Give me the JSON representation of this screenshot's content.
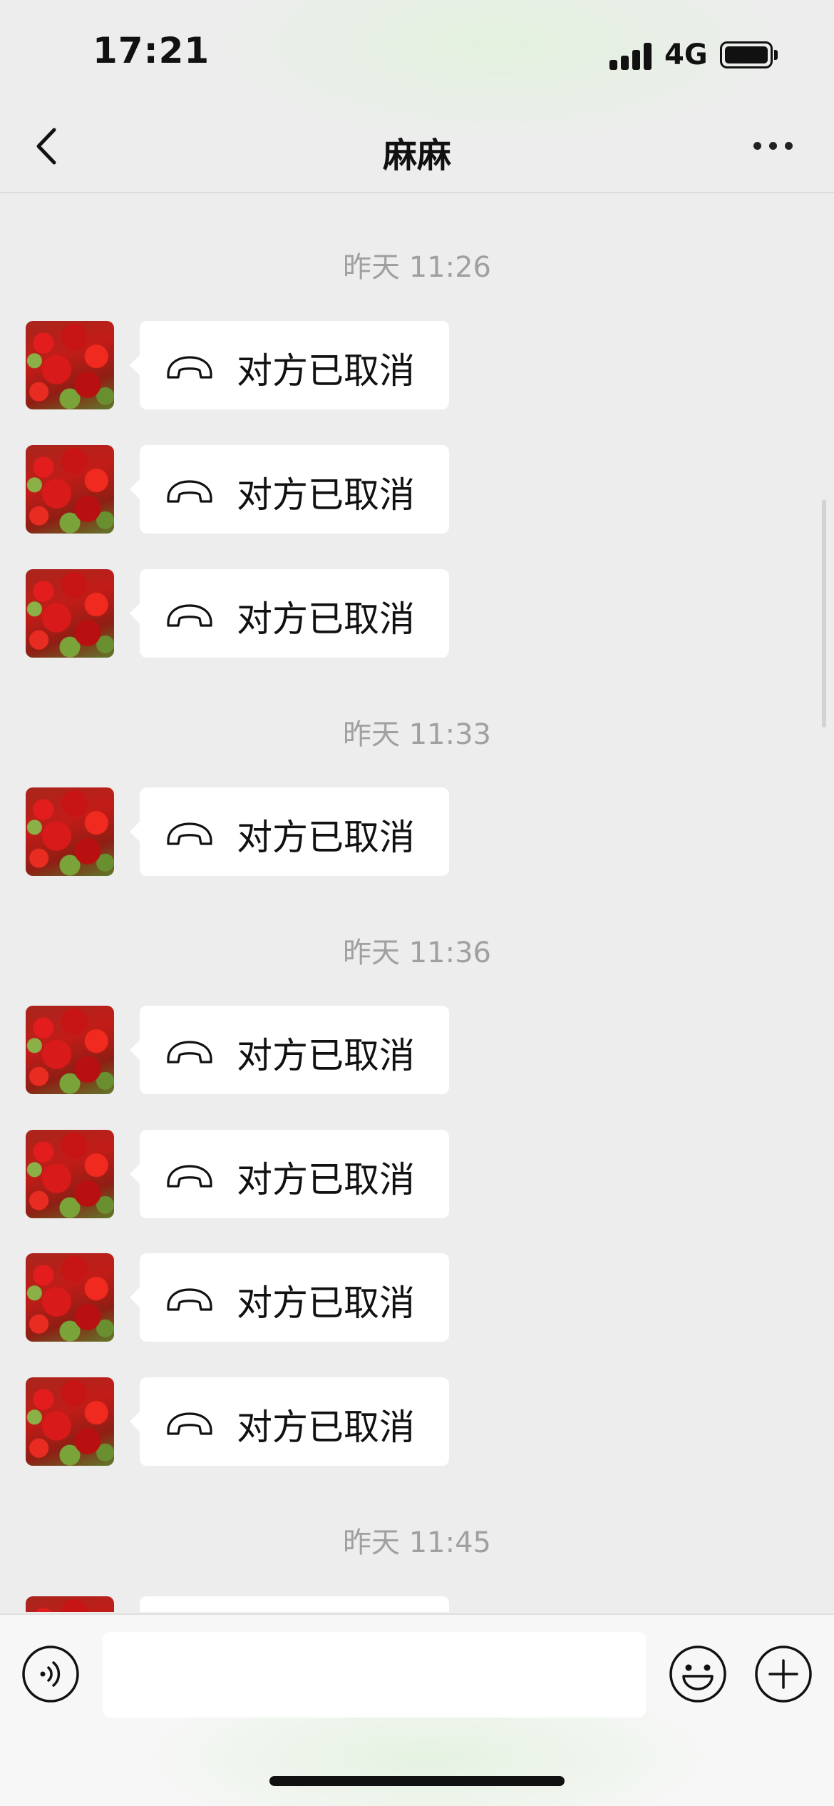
{
  "status_bar": {
    "time": "17:21",
    "network": "4G",
    "signal_icon": "signal-bars-icon",
    "battery_icon": "battery-full-icon"
  },
  "header": {
    "back_icon": "chevron-left-icon",
    "title": "麻麻",
    "more_icon": "ellipsis-icon"
  },
  "messages": [
    {
      "type": "timestamp",
      "text": "昨天 11:26"
    },
    {
      "type": "call",
      "text": "对方已取消",
      "icon": "phone-hangup-icon"
    },
    {
      "type": "call",
      "text": "对方已取消",
      "icon": "phone-hangup-icon"
    },
    {
      "type": "call",
      "text": "对方已取消",
      "icon": "phone-hangup-icon"
    },
    {
      "type": "timestamp",
      "text": "昨天 11:33"
    },
    {
      "type": "call",
      "text": "对方已取消",
      "icon": "phone-hangup-icon"
    },
    {
      "type": "timestamp",
      "text": "昨天 11:36"
    },
    {
      "type": "call",
      "text": "对方已取消",
      "icon": "phone-hangup-icon"
    },
    {
      "type": "call",
      "text": "对方已取消",
      "icon": "phone-hangup-icon"
    },
    {
      "type": "call",
      "text": "对方已取消",
      "icon": "phone-hangup-icon"
    },
    {
      "type": "call",
      "text": "对方已取消",
      "icon": "phone-hangup-icon"
    },
    {
      "type": "timestamp",
      "text": "昨天 11:45"
    }
  ],
  "input_bar": {
    "voice_icon": "voice-input-icon",
    "text_value": "",
    "emoji_icon": "emoji-icon",
    "plus_icon": "plus-circle-icon"
  },
  "colors": {
    "background": "#ededed",
    "bubble": "#ffffff",
    "timestamp_text": "#a0a0a0"
  }
}
